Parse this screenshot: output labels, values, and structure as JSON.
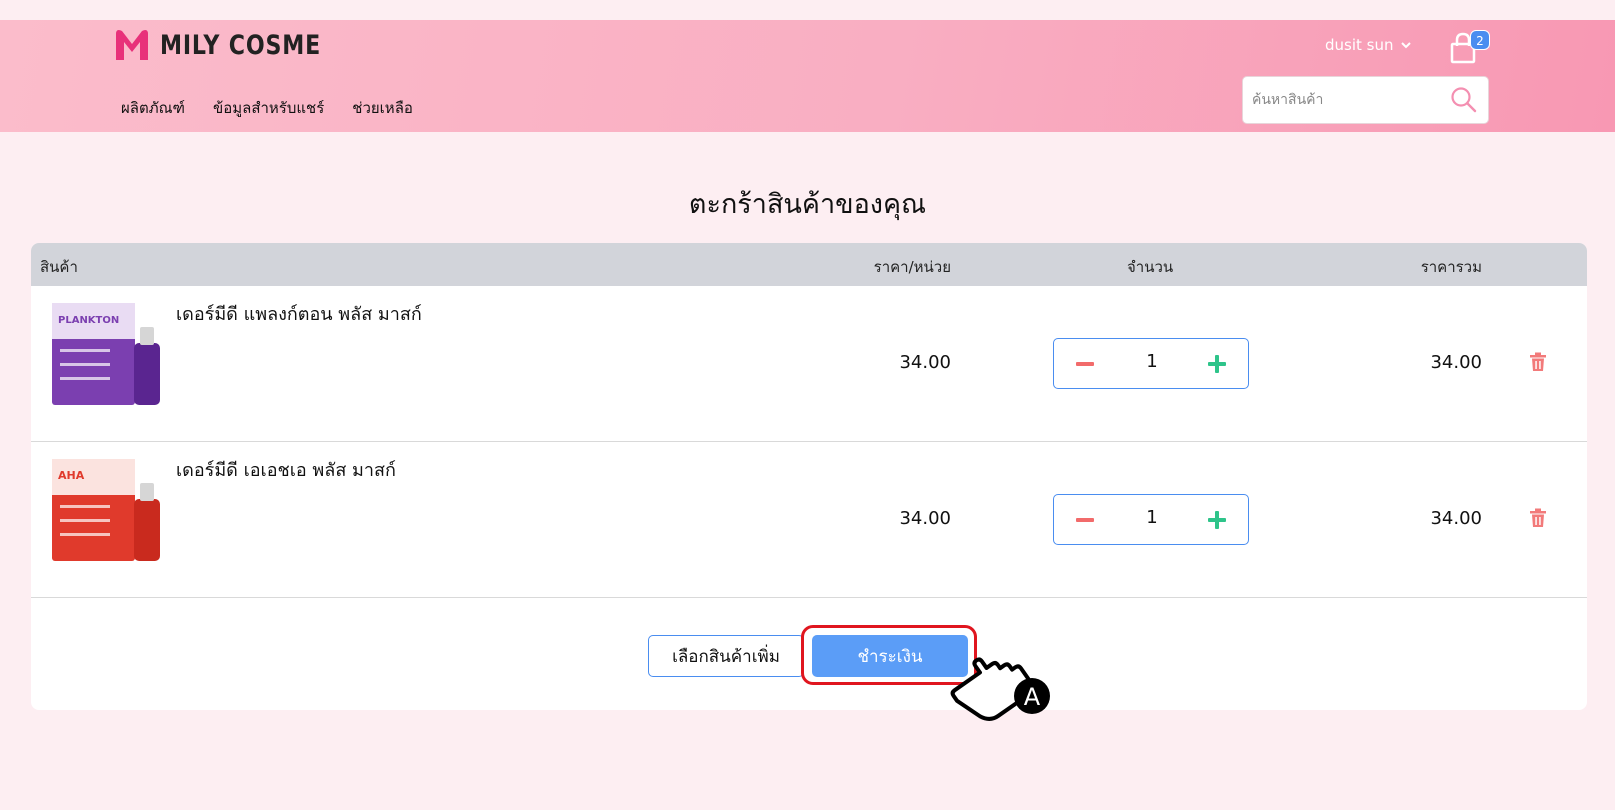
{
  "header": {
    "logo_text": "MILY COSME",
    "nav": [
      "ผลิตภัณฑ์",
      "ข้อมูลสำหรับแชร์",
      "ช่วยเหลือ"
    ],
    "user_name": "dusit sun",
    "cart_count": "2",
    "search_placeholder": "ค้นหาสินค้า"
  },
  "page_title": "ตะกร้าสินค้าของคุณ",
  "table": {
    "headers": {
      "product": "สินค้า",
      "unit_price": "ราคา/หน่วย",
      "quantity": "จำนวน",
      "total": "ราคารวม"
    },
    "rows": [
      {
        "name": "เดอร์มีดี แพลงก์ตอน พลัส มาสก์",
        "thumb_label": "PLANKTON",
        "thumb_color": "#7b3fb0",
        "price": "34.00",
        "quantity": "1",
        "total": "34.00"
      },
      {
        "name": "เดอร์มีดี เอเอชเอ พลัส มาสก์",
        "thumb_label": "AHA",
        "thumb_color": "#e03a2c",
        "price": "34.00",
        "quantity": "1",
        "total": "34.00"
      }
    ]
  },
  "buttons": {
    "continue_shopping": "เลือกสินค้าเพิ่ม",
    "checkout": "ชำระเงิน"
  },
  "annotation": {
    "marker": "A"
  },
  "colors": {
    "accent": "#4a8df0",
    "checkout": "#5b9df7",
    "highlight": "#e0161f",
    "minus": "#f26b6b",
    "plus": "#2ec48a",
    "trash": "#f27a7a"
  }
}
